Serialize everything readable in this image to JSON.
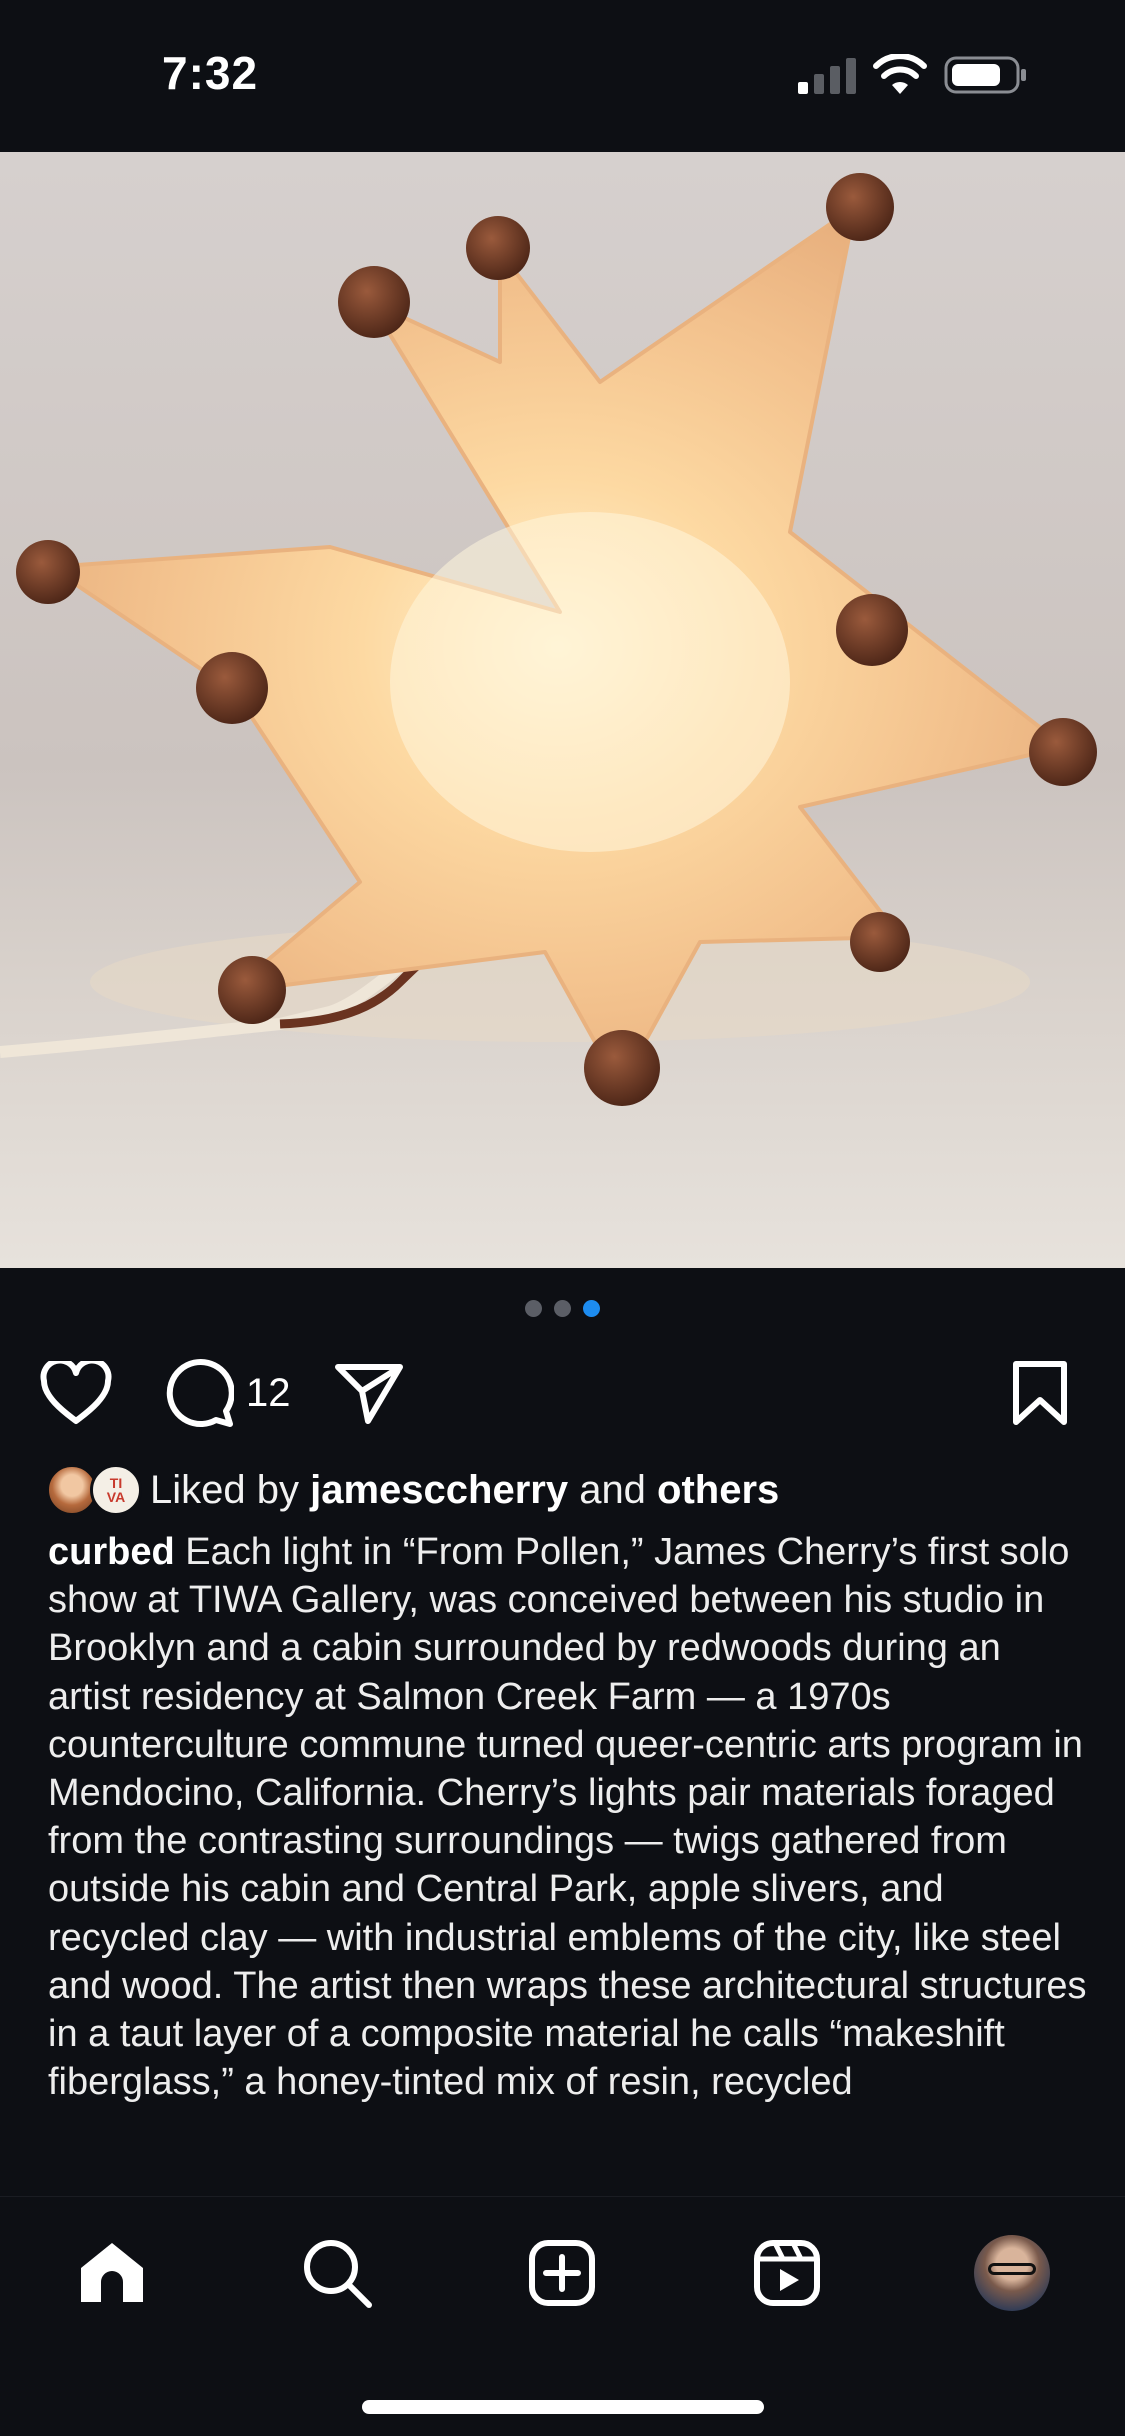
{
  "status_bar": {
    "time": "7:32"
  },
  "post": {
    "image_alt": "Glowing star-shaped lamp with dark spherical tips",
    "carousel": {
      "count": 3,
      "active_index": 2
    },
    "comment_count": "12",
    "likes": {
      "prefix": "Liked by ",
      "user": "jamesccherry",
      "middle": " and ",
      "others": "others"
    },
    "caption": {
      "username": "curbed",
      "text": " Each light in “From Pollen,” James Cherry’s first solo show at TIWA Gallery, was conceived between his studio in Brooklyn and a cabin surrounded by redwoods during an artist residency at Salmon Creek Farm — a 1970s counterculture commune turned queer-centric arts program in Mendocino, California. Cherry’s lights pair materials foraged from the contrasting surroundings —  twigs gathered from outside his cabin and Central Park, apple slivers, and recycled clay — with industrial emblems of the city, like steel and wood. The artist then wraps these architectural structures in a taut layer of a composite material he calls “makeshift fiberglass,” a honey-tinted mix of resin, recycled"
    },
    "avatar2_text": [
      "TI",
      "VA"
    ]
  },
  "nav": {
    "items": [
      "home-icon",
      "search-icon",
      "create-icon",
      "reels-icon",
      "profile-avatar"
    ]
  },
  "colors": {
    "background": "#0d0f14",
    "accent_dot": "#1d8cf0"
  }
}
